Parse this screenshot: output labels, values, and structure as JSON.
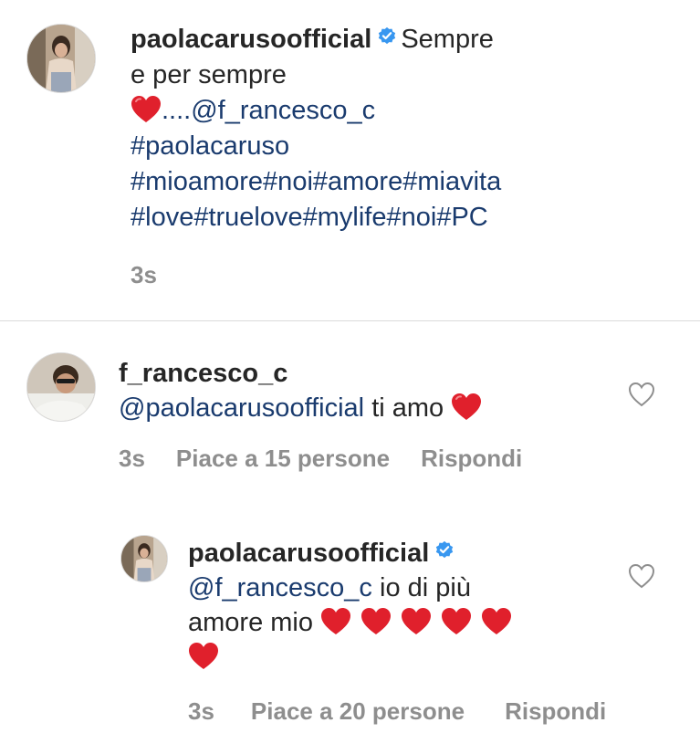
{
  "caption": {
    "username": "paolacarusoofficial",
    "text_line1": "Sempre",
    "text_line2": "e per sempre",
    "dots": "....",
    "mention": "@f_rancesco_c",
    "hashtags_line1": "#paolacaruso",
    "hashtags_line2": "#mioamore#noi#amore#miavita",
    "hashtags_line3": "#love#truelove#mylife#noi#PC",
    "time": "3s"
  },
  "comment1": {
    "username": "f_rancesco_c",
    "mention": "@paolacarusoofficial",
    "text": "ti amo",
    "time": "3s",
    "likes": "Piace a 15 persone",
    "reply": "Rispondi"
  },
  "comment2": {
    "username": "paolacarusoofficial",
    "mention": "@f_rancesco_c",
    "text_line1": "io di più",
    "text_line2": "amore mio",
    "time": "3s",
    "likes": "Piace a 20 persone",
    "reply": "Rispondi"
  },
  "colors": {
    "text": "#262626",
    "link": "#1a3b6e",
    "meta": "#8e8e8e",
    "verified": "#3897f0",
    "heart": "#e0202c"
  },
  "icons": [
    "verified-badge-icon",
    "red-heart-emoji-icon",
    "heart-outline-icon"
  ]
}
